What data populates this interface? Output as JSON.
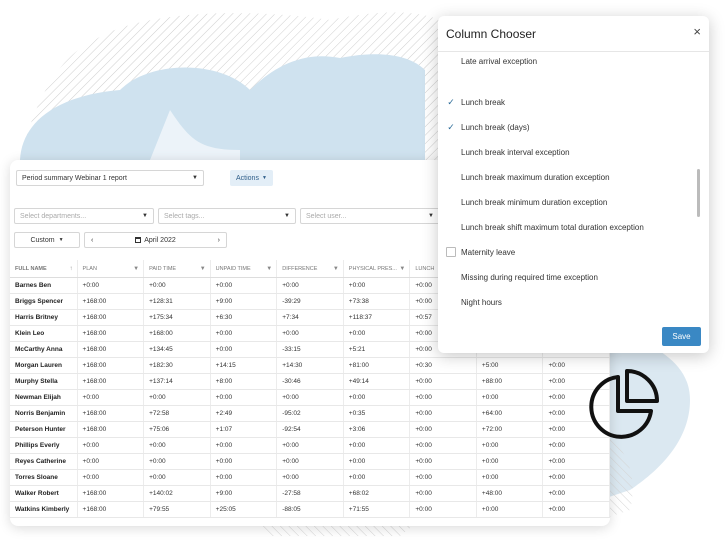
{
  "toolbar": {
    "report_select": "Period summary Webinar 1 report",
    "actions_label": "Actions",
    "departments_placeholder": "Select departments...",
    "tags_placeholder": "Select tags...",
    "user_placeholder": "Select user...",
    "period_mode": "Custom",
    "month_label": "April 2022"
  },
  "table": {
    "headers": [
      "FULL NAME",
      "PLAN",
      "PAID TIME",
      "UNPAID TIME",
      "DIFFERENCE",
      "PHYSICAL PRES...",
      "LUNCH",
      "",
      ""
    ],
    "rows": [
      [
        "Barnes Ben",
        "+0:00",
        "+0:00",
        "+0:00",
        "+0:00",
        "+0:00",
        "+0:00",
        "",
        ""
      ],
      [
        "Briggs Spencer",
        "+168:00",
        "+128:31",
        "+9:00",
        "-39:29",
        "+73:38",
        "+0:00",
        "",
        ""
      ],
      [
        "Harris Britney",
        "+168:00",
        "+175:34",
        "+6:30",
        "+7:34",
        "+118:37",
        "+0:57",
        "",
        ""
      ],
      [
        "Klein Leo",
        "+168:00",
        "+168:00",
        "+0:00",
        "+0:00",
        "+0:00",
        "+0:00",
        "",
        ""
      ],
      [
        "McCarthy Anna",
        "+168:00",
        "+134:45",
        "+0:00",
        "-33:15",
        "+5:21",
        "+0:00",
        "",
        ""
      ],
      [
        "Morgan Lauren",
        "+168:00",
        "+182:30",
        "+14:15",
        "+14:30",
        "+81:00",
        "+0:30",
        "+5:00",
        "+0:00"
      ],
      [
        "Murphy Stella",
        "+168:00",
        "+137:14",
        "+8:00",
        "-30:46",
        "+49:14",
        "+0:00",
        "+88:00",
        "+0:00"
      ],
      [
        "Newman Elijah",
        "+0:00",
        "+0:00",
        "+0:00",
        "+0:00",
        "+0:00",
        "+0:00",
        "+0:00",
        "+0:00"
      ],
      [
        "Norris Benjamin",
        "+168:00",
        "+72:58",
        "+2:49",
        "-95:02",
        "+0:35",
        "+0:00",
        "+64:00",
        "+0:00"
      ],
      [
        "Peterson Hunter",
        "+168:00",
        "+75:06",
        "+1:07",
        "-92:54",
        "+3:06",
        "+0:00",
        "+72:00",
        "+0:00"
      ],
      [
        "Phillips Everly",
        "+0:00",
        "+0:00",
        "+0:00",
        "+0:00",
        "+0:00",
        "+0:00",
        "+0:00",
        "+0:00"
      ],
      [
        "Reyes Catherine",
        "+0:00",
        "+0:00",
        "+0:00",
        "+0:00",
        "+0:00",
        "+0:00",
        "+0:00",
        "+0:00"
      ],
      [
        "Torres Sloane",
        "+0:00",
        "+0:00",
        "+0:00",
        "+0:00",
        "+0:00",
        "+0:00",
        "+0:00",
        "+0:00"
      ],
      [
        "Walker Robert",
        "+168:00",
        "+140:02",
        "+9:00",
        "-27:58",
        "+68:02",
        "+0:00",
        "+48:00",
        "+0:00"
      ],
      [
        "Watkins Kimberly",
        "+168:00",
        "+79:55",
        "+25:05",
        "-88:05",
        "+71:55",
        "+0:00",
        "+0:00",
        "+0:00"
      ]
    ]
  },
  "column_chooser": {
    "title": "Column Chooser",
    "close": "×",
    "options": [
      {
        "label": "Late arrival exception",
        "checked": false
      },
      {
        "label": "Lunch break",
        "checked": true
      },
      {
        "label": "Lunch break (days)",
        "checked": true
      },
      {
        "label": "Lunch break interval exception",
        "checked": false
      },
      {
        "label": "Lunch break maximum duration exception",
        "checked": false
      },
      {
        "label": "Lunch break minimum duration exception",
        "checked": false
      },
      {
        "label": "Lunch break shift maximum total duration exception",
        "checked": false
      },
      {
        "label": "Maternity leave",
        "checked": false,
        "outlined": true
      },
      {
        "label": "Missing during required time exception",
        "checked": false
      },
      {
        "label": "Night hours",
        "checked": false
      }
    ],
    "save_label": "Save"
  },
  "icons": {
    "check": "check-icon",
    "filter": "filter-icon",
    "pie": "pie-chart-icon"
  },
  "colors": {
    "accent": "#3a88c4",
    "actions_bg": "#e3eef7",
    "blob": "#cfe2ef"
  }
}
